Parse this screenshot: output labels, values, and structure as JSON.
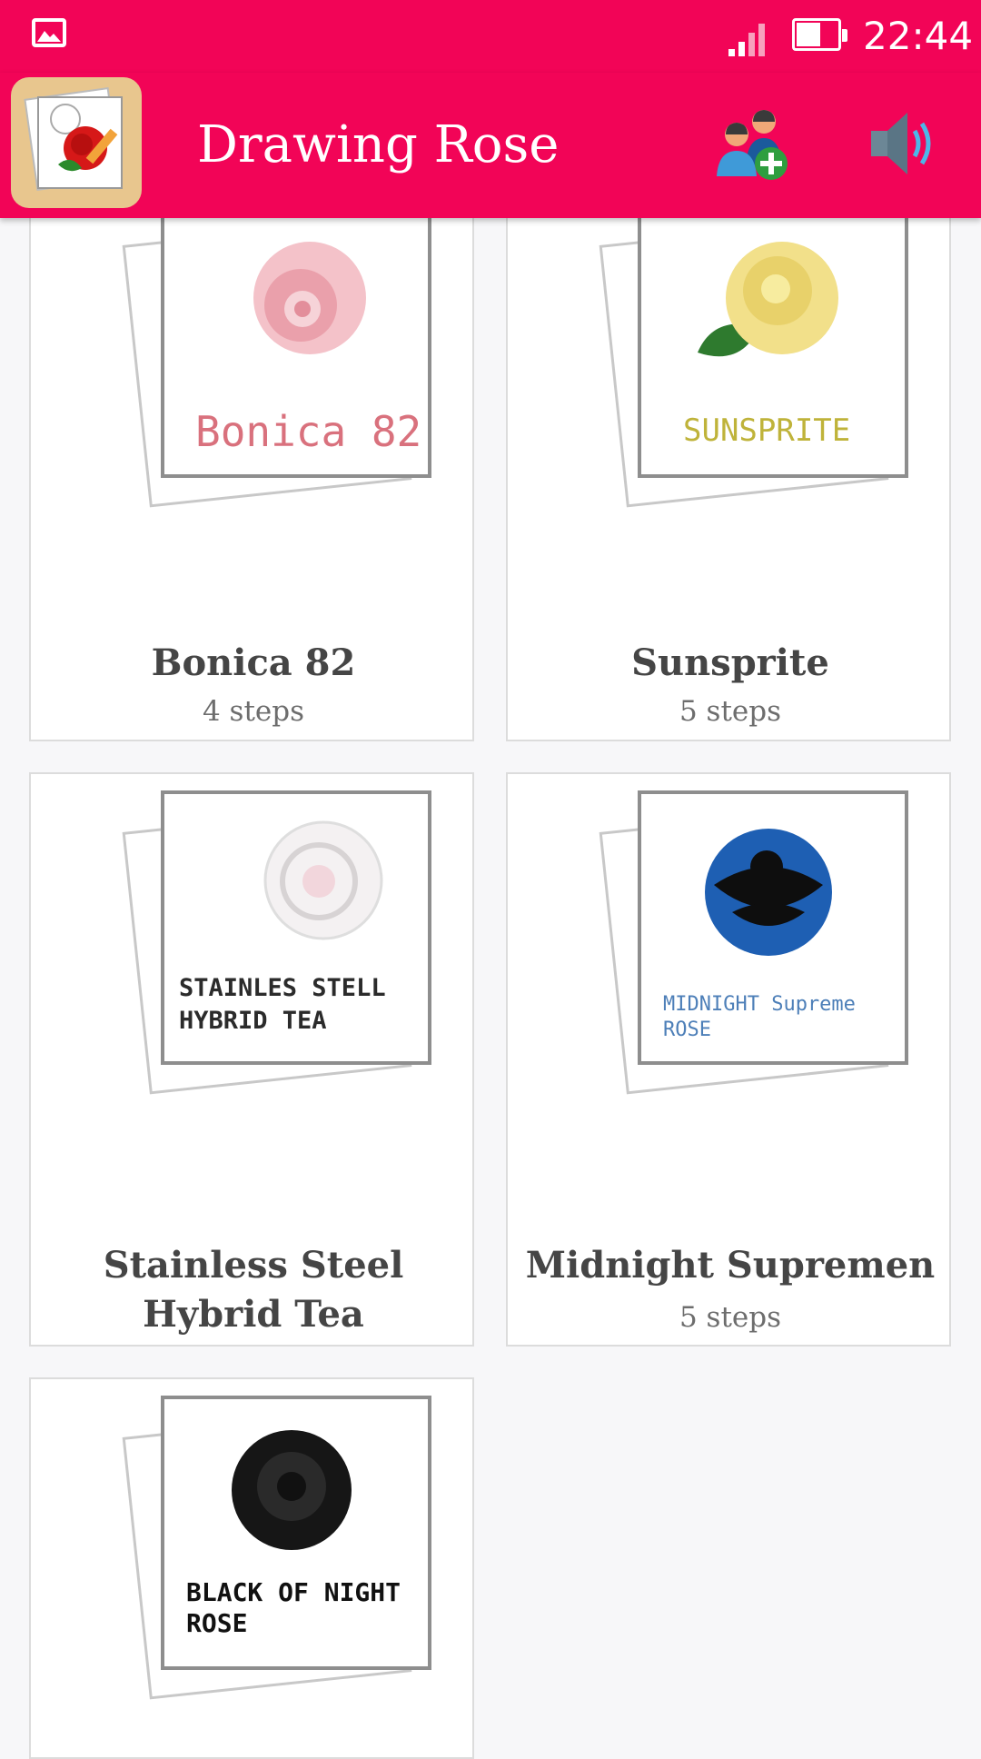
{
  "status_bar": {
    "time": "22:44",
    "battery_level": 0.6
  },
  "app_bar": {
    "title": "Drawing Rose"
  },
  "colors": {
    "primary": "#f20457",
    "card_bg": "#ffffff",
    "title_text": "#454545",
    "steps_text": "#6d6d6d"
  },
  "icons": [
    "gallery-icon",
    "signal-icon",
    "battery-icon",
    "app-logo",
    "add-friends-icon",
    "sound-icon"
  ],
  "cards": [
    {
      "title": "Bonica 82",
      "steps": "4 steps",
      "drawing_caption": "Bonica 82",
      "rose_color": "#f4b3be"
    },
    {
      "title": "Sunsprite",
      "steps": "5 steps",
      "drawing_caption": "SUNSPRITE",
      "rose_color": "#f3e38c"
    },
    {
      "title": "Stainless Steel Hybrid Tea",
      "steps": "",
      "drawing_caption": "STAINLES STELL HYBRID TEA",
      "rose_color": "#e8e2e4"
    },
    {
      "title": "Midnight Supremen",
      "steps": "5 steps",
      "drawing_caption": "MIDNIGHT Supreme ROSE",
      "rose_color": "#1e5fb3"
    },
    {
      "title": "",
      "steps": "",
      "drawing_caption": "BLACK OF NIGHT ROSE",
      "rose_color": "#161616"
    }
  ]
}
